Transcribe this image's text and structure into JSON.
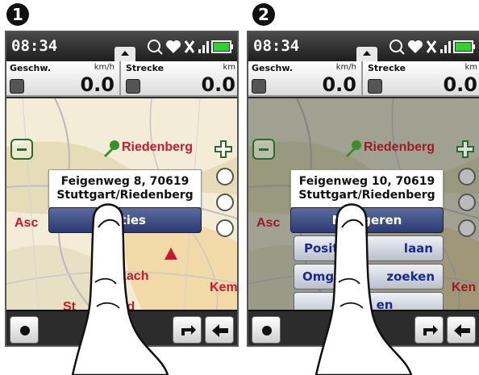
{
  "steps": [
    {
      "number": "1",
      "clock": "08:34",
      "speed": {
        "label": "Geschw.",
        "unit": "km/h",
        "value": "0.0"
      },
      "distance": {
        "label": "Strecke",
        "unit": "km",
        "value": "0.0"
      },
      "map_labels": {
        "riedenberg": "Riedenberg",
        "asc": "Asc",
        "kach": "kach",
        "st": "St",
        "ld": "ld",
        "kem": "Kem"
      },
      "address": {
        "line1": "Feigenweg 8, 70619",
        "line2": "Stuttgart/Riedenberg"
      },
      "menu": [
        "Acties"
      ]
    },
    {
      "number": "2",
      "clock": "08:34",
      "speed": {
        "label": "Geschw.",
        "unit": "km/h",
        "value": "0.0"
      },
      "distance": {
        "label": "Strecke",
        "unit": "km",
        "value": "0.0"
      },
      "map_labels": {
        "riedenberg": "Riedenberg",
        "asc": "Asc",
        "kem": "Ken"
      },
      "address": {
        "line1": "Feigenweg 10, 70619",
        "line2": "Stuttgart/Riedenberg"
      },
      "menu": [
        "Navigeren",
        "Posit",
        "laan",
        "Omgev",
        "zoeken",
        "en"
      ]
    }
  ],
  "icons": {
    "zoom_in": "plus-icon",
    "zoom_out": "minus-icon",
    "bike": "bicycle-icon",
    "compass": "compass-icon",
    "direction": "direction-icon",
    "record": "record-icon",
    "rotate": "rotate-screen-icon",
    "back": "back-arrow-icon",
    "position": "position-arrow-icon"
  },
  "colors": {
    "accent_blue": "#2b3a72",
    "map_label": "#c8182a",
    "battery": "#2fd32f"
  }
}
